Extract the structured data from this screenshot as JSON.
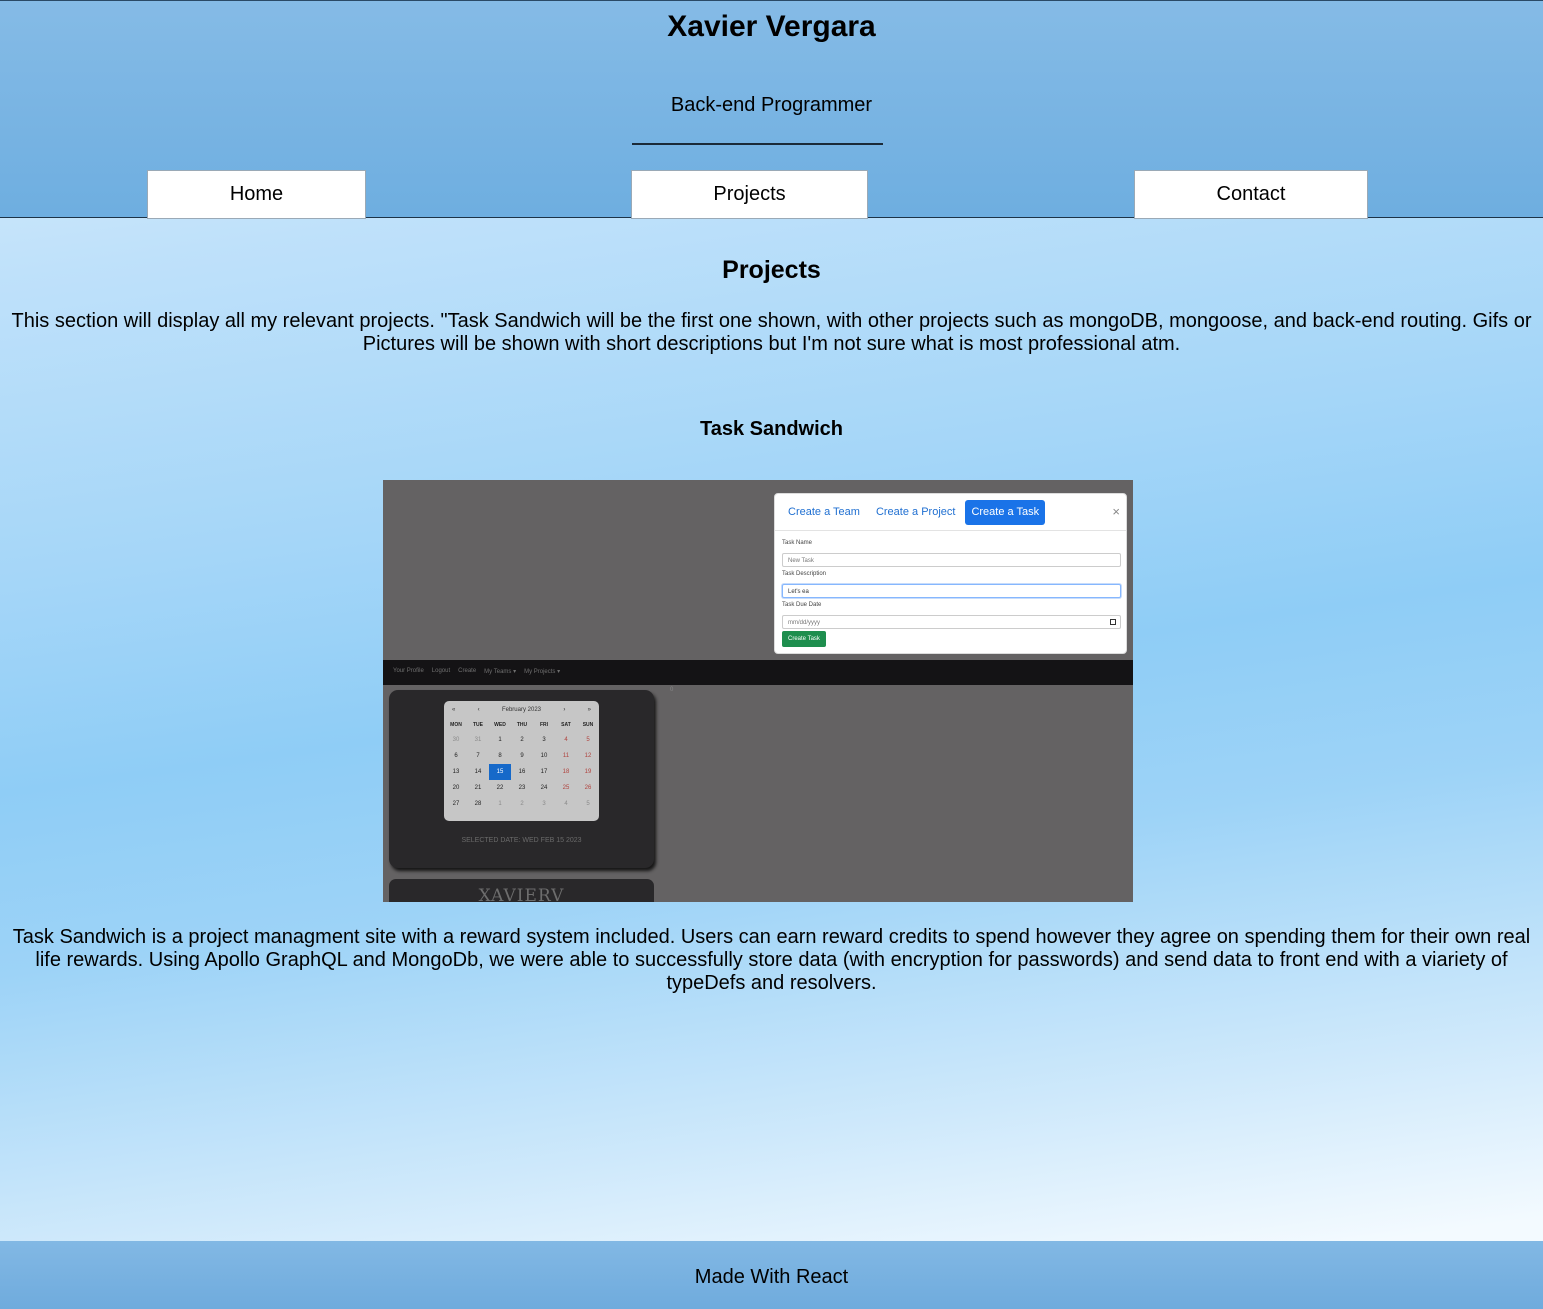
{
  "header": {
    "title": "Xavier Vergara",
    "subtitle": "Back-end Programmer",
    "nav": [
      {
        "label": "Home"
      },
      {
        "label": "Projects"
      },
      {
        "label": "Contact"
      }
    ]
  },
  "main": {
    "section_title": "Projects",
    "section_description": "This section will display all my relevant projects. \"Task Sandwich will be the first one shown, with other projects such as mongoDB, mongoose, and back-end routing. Gifs or Pictures will be shown with short descriptions but I'm not sure what is most professional atm.",
    "project": {
      "title": "Task Sandwich",
      "description": "Task Sandwich is a project managment site with a reward system included. Users can earn reward credits to spend however they agree on spending them for their own real life rewards. Using Apollo GraphQL and MongoDb, we were able to successfully store data (with encryption for passwords) and send data to front end with a viariety of typeDefs and resolvers.",
      "screenshot": {
        "modal_tabs": [
          "Create a Team",
          "Create a Project",
          "Create a Task"
        ],
        "modal_close": "×",
        "task_name_label": "Task Name",
        "task_name_value": "New Task",
        "task_desc_label": "Task Description",
        "task_desc_value": "Let's ea",
        "task_due_label": "Task Due Date",
        "task_due_placeholder": "mm/dd/yyyy",
        "create_button": "Create Task",
        "app_nav": [
          "Your Profile",
          "Logout",
          "Create",
          "My Teams ▾",
          "My Projects ▾"
        ],
        "stray_mark": "0",
        "calendar": {
          "month": "February 2023",
          "prev2": "«",
          "prev": "‹",
          "next": "›",
          "next2": "»",
          "weekdays": [
            "MON",
            "TUE",
            "WED",
            "THU",
            "FRI",
            "SAT",
            "SUN"
          ],
          "weeks": [
            [
              "30",
              "31",
              "1",
              "2",
              "3",
              "4",
              "5"
            ],
            [
              "6",
              "7",
              "8",
              "9",
              "10",
              "11",
              "12"
            ],
            [
              "13",
              "14",
              "15",
              "16",
              "17",
              "18",
              "19"
            ],
            [
              "20",
              "21",
              "22",
              "23",
              "24",
              "25",
              "26"
            ],
            [
              "27",
              "28",
              "1",
              "2",
              "3",
              "4",
              "5"
            ]
          ],
          "selected_day": "15",
          "selected_text": "SELECTED DATE: WED FEB 15 2023"
        },
        "brand_text": "XAVIERV"
      }
    }
  },
  "footer": {
    "text": "Made With React"
  }
}
